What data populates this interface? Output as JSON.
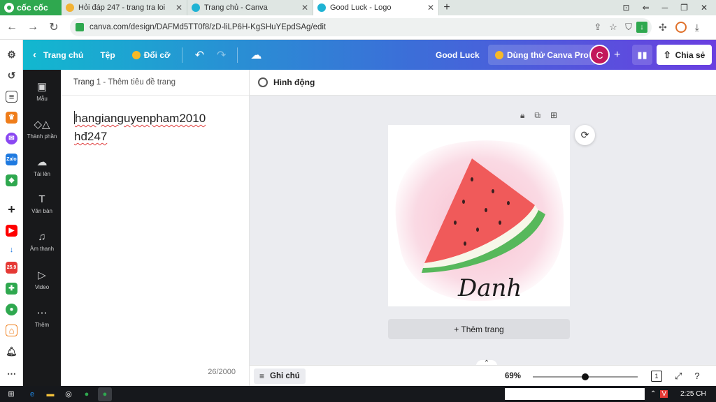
{
  "browser": {
    "brand": "cốc cốc",
    "tabs": [
      {
        "title": "Hỏi đáp 247 - trang tra loi",
        "favicon_color": "#f2b233"
      },
      {
        "title": "Trang chủ - Canva",
        "favicon_color": "#1fb3d4"
      },
      {
        "title": "Good Luck - Logo",
        "favicon_color": "#1fb3d4"
      }
    ],
    "url": "canva.com/design/DAFMd5TT0f8/zD-liLP6H-KgSHuYEpdSAg/edit"
  },
  "canva": {
    "topbar": {
      "home": "Trang chủ",
      "file": "Tệp",
      "resize": "Đổi cỡ",
      "design_title": "Good Luck",
      "try_pro": "Dùng thử Canva Pro",
      "avatar_letter": "C",
      "share": "Chia sẻ"
    },
    "sidepanel": [
      {
        "label": "Mẫu",
        "icon": "template-icon"
      },
      {
        "label": "Thành phần",
        "icon": "elements-icon"
      },
      {
        "label": "Tải lên",
        "icon": "upload-icon"
      },
      {
        "label": "Văn bản",
        "icon": "text-icon"
      },
      {
        "label": "Âm thanh",
        "icon": "music-icon"
      },
      {
        "label": "Video",
        "icon": "video-icon"
      },
      {
        "label": "Thêm",
        "icon": "more-icon"
      }
    ],
    "notes": {
      "page_label": "Trang 1",
      "add_title": "Thêm tiêu đề trang",
      "line1": "hangianguyenpham2010",
      "line2": "hđ247",
      "count": "26/2000"
    },
    "animate": "Hình động",
    "artwork_text": "Danh",
    "add_page": "+ Thêm trang",
    "notes_button": "Ghi chú",
    "zoom": "69%",
    "zoom_level": 0.5,
    "page_count": "1",
    "colors": {
      "accent_start": "#12b8cf",
      "accent_end": "#6a3fe0"
    }
  },
  "taskbar": {
    "clock": "2:25 CH"
  }
}
